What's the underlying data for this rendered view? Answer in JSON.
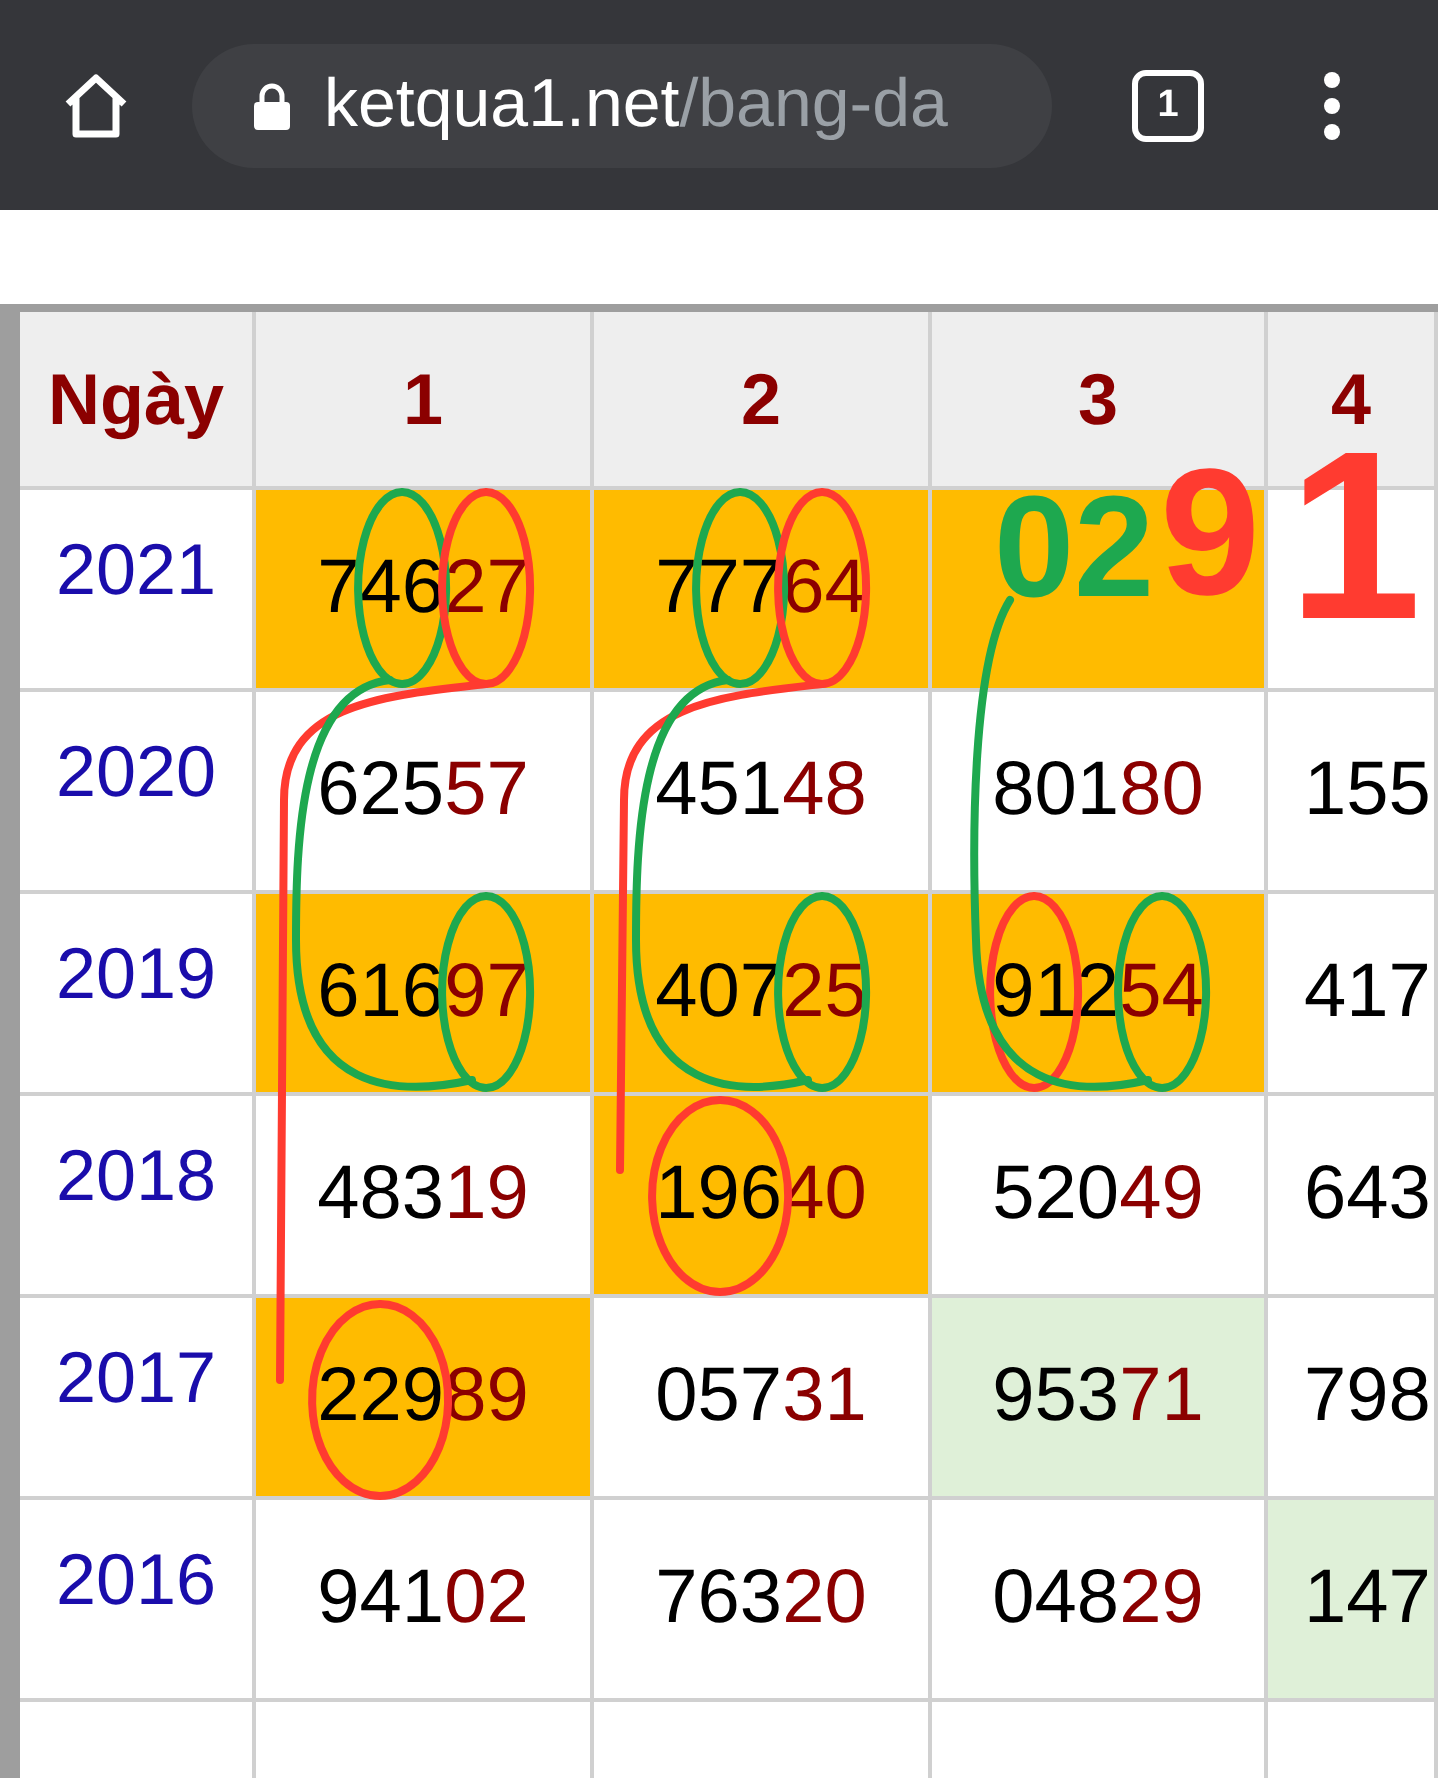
{
  "browser": {
    "url_host": "ketqua1.net",
    "url_path": "/bang-da",
    "tab_count": "1"
  },
  "table": {
    "columns": [
      "Ngày",
      "1",
      "2",
      "3",
      "4"
    ],
    "rows": [
      {
        "cells": [
          {
            "kind": "year",
            "text": "2021"
          },
          {
            "kind": "hot",
            "head": "746",
            "tail": "27"
          },
          {
            "kind": "hot",
            "head": "777",
            "tail": "64"
          },
          {
            "kind": "hot"
          },
          {
            "kind": "plain"
          }
        ]
      },
      {
        "cells": [
          {
            "kind": "year",
            "text": "2020"
          },
          {
            "kind": "plain",
            "head": "625",
            "tail": "57"
          },
          {
            "kind": "plain",
            "head": "451",
            "tail": "48"
          },
          {
            "kind": "plain",
            "head": "801",
            "tail": "80"
          },
          {
            "kind": "plain",
            "head": "155"
          }
        ]
      },
      {
        "cells": [
          {
            "kind": "year",
            "text": "2019"
          },
          {
            "kind": "hot",
            "head": "616",
            "tail": "97"
          },
          {
            "kind": "hot",
            "head": "407",
            "tail": "25"
          },
          {
            "kind": "hot",
            "head": "912",
            "tail": "54"
          },
          {
            "kind": "plain",
            "head": "417"
          }
        ]
      },
      {
        "cells": [
          {
            "kind": "year",
            "text": "2018"
          },
          {
            "kind": "plain",
            "head": "483",
            "tail": "19"
          },
          {
            "kind": "hot",
            "head": "196",
            "tail": "40"
          },
          {
            "kind": "plain",
            "head": "520",
            "tail": "49"
          },
          {
            "kind": "plain",
            "head": "643"
          }
        ]
      },
      {
        "cells": [
          {
            "kind": "year",
            "text": "2017"
          },
          {
            "kind": "hot",
            "head": "229",
            "tail": "89"
          },
          {
            "kind": "plain",
            "head": "057",
            "tail": "31"
          },
          {
            "kind": "near",
            "head": "953",
            "tail": "71"
          },
          {
            "kind": "plain",
            "head": "798"
          }
        ]
      },
      {
        "cells": [
          {
            "kind": "year",
            "text": "2016"
          },
          {
            "kind": "plain",
            "head": "941",
            "tail": "02"
          },
          {
            "kind": "plain",
            "head": "763",
            "tail": "20"
          },
          {
            "kind": "plain",
            "head": "048",
            "tail": "29"
          },
          {
            "kind": "near",
            "head": "147"
          }
        ]
      }
    ]
  },
  "annotations": [
    {
      "text": "02",
      "color": "#1ea84f"
    },
    {
      "text": "9",
      "color": "#ff3b30"
    },
    {
      "text": "1",
      "color": "#ff3b30"
    }
  ]
}
